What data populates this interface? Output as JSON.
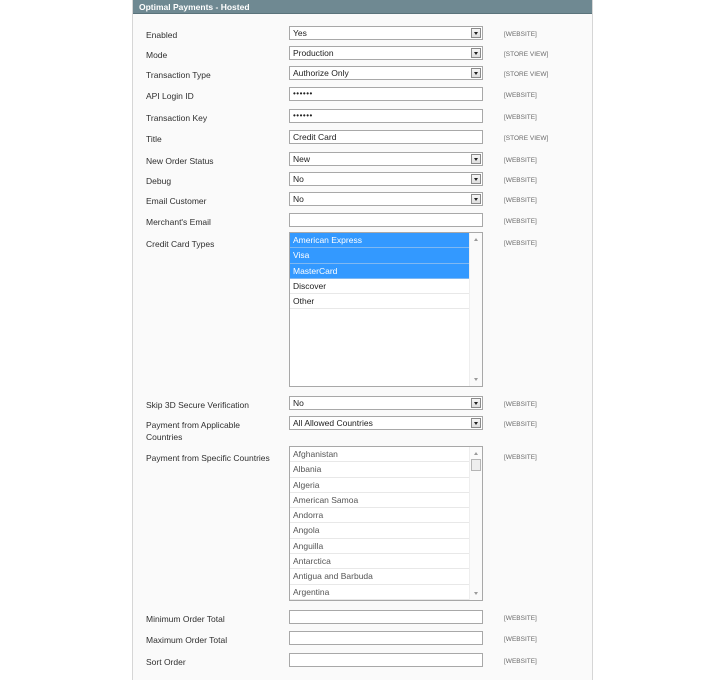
{
  "panel": {
    "title": "Optimal Payments - Hosted"
  },
  "fields": {
    "enabled": {
      "label": "Enabled",
      "value": "Yes",
      "scope": "[WEBSITE]"
    },
    "mode": {
      "label": "Mode",
      "value": "Production",
      "scope": "[STORE VIEW]"
    },
    "transaction_type": {
      "label": "Transaction Type",
      "value": "Authorize Only",
      "scope": "[STORE VIEW]"
    },
    "api_login_id": {
      "label": "API Login ID",
      "value": "••••••",
      "scope": "[WEBSITE]"
    },
    "transaction_key": {
      "label": "Transaction Key",
      "value": "••••••",
      "scope": "[WEBSITE]"
    },
    "title": {
      "label": "Title",
      "value": "Credit Card",
      "scope": "[STORE VIEW]"
    },
    "new_order_status": {
      "label": "New Order Status",
      "value": "New",
      "scope": "[WEBSITE]"
    },
    "debug": {
      "label": "Debug",
      "value": "No",
      "scope": "[WEBSITE]"
    },
    "email_customer": {
      "label": "Email Customer",
      "value": "No",
      "scope": "[WEBSITE]"
    },
    "merchant_email": {
      "label": "Merchant's Email",
      "value": "",
      "scope": "[WEBSITE]"
    },
    "cc_types": {
      "label": "Credit Card Types",
      "scope": "[WEBSITE]",
      "options": [
        {
          "label": "American Express",
          "selected": true
        },
        {
          "label": "Visa",
          "selected": true
        },
        {
          "label": "MasterCard",
          "selected": true
        },
        {
          "label": "Discover",
          "selected": false
        },
        {
          "label": "Other",
          "selected": false
        }
      ]
    },
    "skip_3d": {
      "label": "Skip 3D Secure Verification",
      "value": "No",
      "scope": "[WEBSITE]"
    },
    "applicable_countries": {
      "label": "Payment from Applicable Countries",
      "value": "All Allowed Countries",
      "scope": "[WEBSITE]"
    },
    "specific_countries": {
      "label": "Payment from Specific Countries",
      "scope": "[WEBSITE]",
      "options": [
        "Afghanistan",
        "Albania",
        "Algeria",
        "American Samoa",
        "Andorra",
        "Angola",
        "Anguilla",
        "Antarctica",
        "Antigua and Barbuda",
        "Argentina"
      ]
    },
    "min_order_total": {
      "label": "Minimum Order Total",
      "value": "",
      "scope": "[WEBSITE]"
    },
    "max_order_total": {
      "label": "Maximum Order Total",
      "value": "",
      "scope": "[WEBSITE]"
    },
    "sort_order": {
      "label": "Sort Order",
      "value": "",
      "scope": "[WEBSITE]"
    }
  }
}
